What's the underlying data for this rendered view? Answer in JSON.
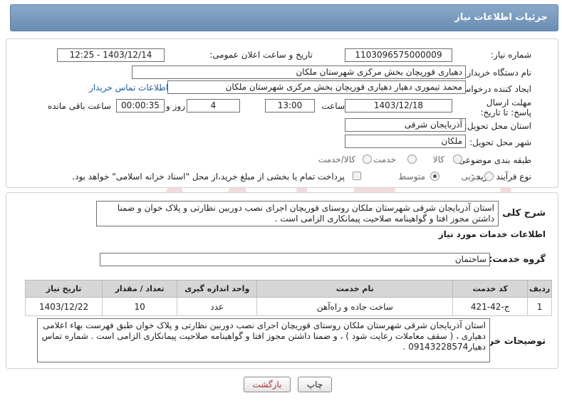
{
  "header": {
    "title": "جزئیات اطلاعات نیاز"
  },
  "fields": {
    "need_number_label": "شماره نیاز:",
    "need_number": "1103096575000009",
    "announce_label": "تاریخ و ساعت اعلان عمومی:",
    "announce_value": "1403/12/14 - 12:25",
    "buyer_org_label": "نام دستگاه خریدار:",
    "buyer_org": "دهیاری قوریچان بخش مرکزی شهرستان ملکان",
    "requester_label": "ایجاد کننده درخواست:",
    "requester": "محمد تیموری دهیار دهیاری قوریچان بخش مرکزی شهرستان ملکان",
    "contact_link": "اطلاعات تماس خریدار",
    "deadline_label": "مهلت ارسال پاسخ: تا تاریخ:",
    "deadline_date": "1403/12/18",
    "time_label": "ساعت",
    "deadline_time": "13:00",
    "days_value": "4",
    "days_label": "روز و",
    "remaining_time": "00:00:35",
    "remaining_label": "ساعت باقی مانده",
    "province_label": "استان محل تحویل:",
    "province": "آذربایجان شرقی",
    "city_label": "شهر محل تحویل:",
    "city": "ملکان",
    "category_label": "طبقه بندی موضوعی:",
    "category_options": [
      "کالا",
      "خدمت",
      "کالا/خدمت"
    ],
    "process_label": "نوع فرآیند خرید :",
    "process_options": [
      "جزیی",
      "متوسط"
    ],
    "payment_note": "پرداخت تمام یا بخشی از مبلغ خرید،از محل \"اسناد خزانه اسلامی\" خواهد بود."
  },
  "description": {
    "label": "شرح کلی نیاز:",
    "text": "استان آذربایجان شرقی شهرستان ملکان روستای قوریچان اجرای نصب دوربین نظارتی و پلاک خوان و ضمنا داشتن مجوز افتا و گواهینامه صلاحیت پیمانکاری الزامی است ."
  },
  "services": {
    "section_title": "اطلاعات خدمات مورد نیاز",
    "group_label": "گروه خدمت:",
    "group_value": "ساختمان",
    "columns": [
      "ردیف",
      "کد خدمت",
      "نام خدمت",
      "واحد اندازه گیری",
      "تعداد / مقدار",
      "تاریخ نیاز"
    ],
    "rows": [
      [
        "1",
        "ج-42-421",
        "ساخت جاده و راه‌آهن",
        "عدد",
        "10",
        "1403/12/22"
      ]
    ]
  },
  "buyer_notes": {
    "label": "توضیحات خریدار:",
    "text": "استان آذربایجان شرقی شهرستان ملکان روستای قوریچان اجرای نصب دوربین نظارتی و پلاک خوان  طبق فهرست بهاء اعلامی دهیاری ، ( سقف معاملات رعایت شود ) ، و ضمنا داشتن مجوز افتا و گواهینامه صلاحیت پیمانکاری الزامی است . شماره تماس دهیار09143228574 ."
  },
  "buttons": {
    "print": "چاپ",
    "back": "بازگشت"
  },
  "watermark": {
    "text": "AriaTender.neT"
  }
}
